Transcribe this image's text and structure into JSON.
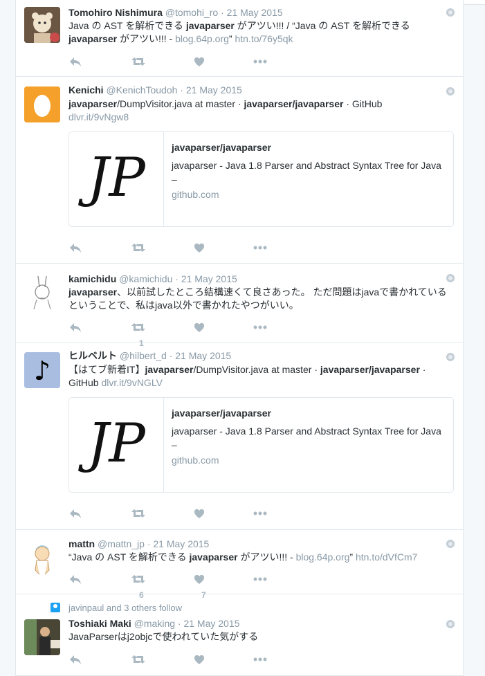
{
  "tweets": [
    {
      "name": "Tomohiro Nishimura",
      "handle": "@tomohi_ro",
      "date": "21 May 2015",
      "t1": "Java の AST を解析できる ",
      "b1": "javaparser",
      "t2": " がアツい!!! / “Java の AST を解析できる ",
      "b2": "javaparser",
      "t3": " がアツい!!! - ",
      "l1": "blog.64p.org",
      "t4": "” ",
      "l2": "htn.to/76y5qk"
    },
    {
      "name": "Kenichi",
      "handle": "@KenichToudoh",
      "date": "21 May 2015",
      "b1": "javaparser",
      "t1": "/DumpVisitor.java at master · ",
      "b2": "javaparser/javaparser",
      "t2": " · GitHub",
      "l1": "dlvr.it/9vNgw8",
      "card": {
        "logo": "JP",
        "title": "javaparser/javaparser",
        "desc": "javaparser - Java 1.8 Parser and Abstract Syntax Tree for Java –",
        "domain": "github.com"
      }
    },
    {
      "name": "kamichidu",
      "handle": "@kamichidu",
      "date": "21 May 2015",
      "b1": "javaparser",
      "t1": "、以前試したところ結構速くて良さあった。 ただ問題はjavaで書かれている",
      "t2": "ということで、私はjava以外で書かれたやつがいい。",
      "retweets": "1"
    },
    {
      "name": "ヒルベルト",
      "handle": "@hilbert_d",
      "date": "21 May 2015",
      "avatar_note": "♪",
      "t1": "【はてブ新着IT】",
      "b1": "javaparser",
      "t2": "/DumpVisitor.java at master · ",
      "b2": "javaparser/javaparser",
      "t3": " ·",
      "t4": "GitHub ",
      "l1": "dlvr.it/9vNGLV",
      "card": {
        "logo": "JP",
        "title": "javaparser/javaparser",
        "desc": "javaparser - Java 1.8 Parser and Abstract Syntax Tree for Java –",
        "domain": "github.com"
      }
    },
    {
      "name": "mattn",
      "handle": "@mattn_jp",
      "date": "21 May 2015",
      "t1": "“Java の AST を解析できる ",
      "b1": "javaparser",
      "t2": " がアツい!!! - ",
      "l1": "blog.64p.org",
      "t3": "” ",
      "l2": "htn.to/dVfCm7",
      "retweets": "6",
      "likes": "7"
    },
    {
      "context": "javinpaul and 3 others follow",
      "name": "Toshiaki Maki",
      "handle": "@making",
      "date": "21 May 2015",
      "t1": "JavaParserはj2objcで使われていた気がする"
    }
  ],
  "sep": " · ",
  "icons": {
    "reply": "reply-icon",
    "retweet": "retweet-icon",
    "like": "heart-icon",
    "more": "more-icon",
    "globe": "globe-icon"
  },
  "colors": {
    "text": "#292f33",
    "muted": "#8899a6",
    "icon": "#aab8c2",
    "accent": "#1da1f2"
  }
}
